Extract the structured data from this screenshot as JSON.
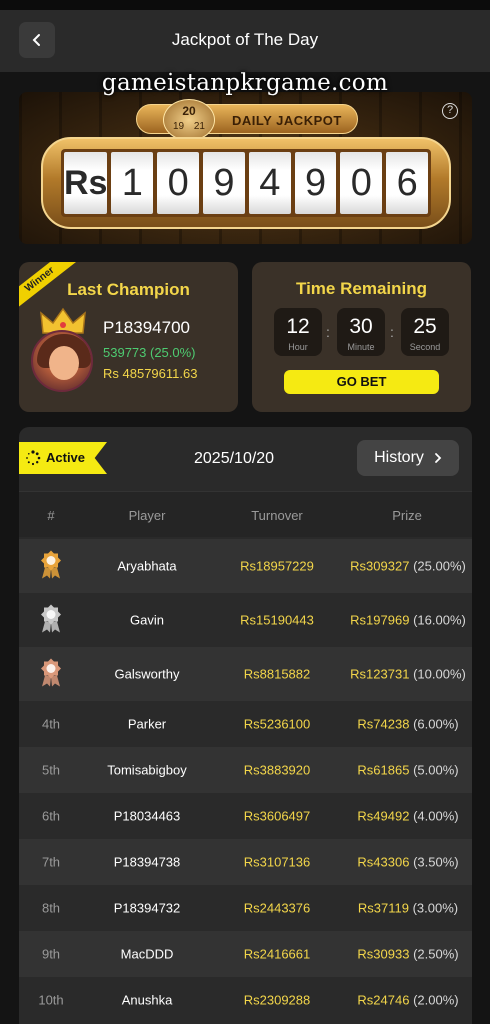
{
  "header": {
    "title": "Jackpot of The Day"
  },
  "watermark": "gameistanpkrgame.com",
  "banner": {
    "label": "DAILY JACKPOT",
    "clock": {
      "day": "20",
      "left": "19",
      "right": "21"
    },
    "currency": "Rs",
    "digits": [
      "1",
      "0",
      "9",
      "4",
      "9",
      "0",
      "6"
    ]
  },
  "champion": {
    "tag": "Winner",
    "title": "Last Champion",
    "name": "P18394700",
    "turnover_rate": "539773 (25.0%)",
    "amount": "Rs 48579611.63"
  },
  "timer": {
    "title": "Time Remaining",
    "hour": "12",
    "hour_label": "Hour",
    "minute": "30",
    "minute_label": "Minute",
    "second": "25",
    "second_label": "Second",
    "button": "GO BET"
  },
  "board": {
    "status": "Active",
    "date": "2025/10/20",
    "history": "History",
    "columns": {
      "rank": "#",
      "player": "Player",
      "turnover": "Turnover",
      "prize": "Prize"
    },
    "rows": [
      {
        "rank": "",
        "medal": "gold",
        "player": "Aryabhata",
        "turnover": "Rs18957229",
        "prize": "Rs309327",
        "pct": "(25.00%)"
      },
      {
        "rank": "",
        "medal": "silver",
        "player": "Gavin",
        "turnover": "Rs15190443",
        "prize": "Rs197969",
        "pct": "(16.00%)"
      },
      {
        "rank": "",
        "medal": "bronze",
        "player": "Galsworthy",
        "turnover": "Rs8815882",
        "prize": "Rs123731",
        "pct": "(10.00%)"
      },
      {
        "rank": "4th",
        "player": "Parker",
        "turnover": "Rs5236100",
        "prize": "Rs74238",
        "pct": "(6.00%)"
      },
      {
        "rank": "5th",
        "player": "Tomisabigboy",
        "turnover": "Rs3883920",
        "prize": "Rs61865",
        "pct": "(5.00%)"
      },
      {
        "rank": "6th",
        "player": "P18034463",
        "turnover": "Rs3606497",
        "prize": "Rs49492",
        "pct": "(4.00%)"
      },
      {
        "rank": "7th",
        "player": "P18394738",
        "turnover": "Rs3107136",
        "prize": "Rs43306",
        "pct": "(3.50%)"
      },
      {
        "rank": "8th",
        "player": "P18394732",
        "turnover": "Rs2443376",
        "prize": "Rs37119",
        "pct": "(3.00%)"
      },
      {
        "rank": "9th",
        "player": "MacDDD",
        "turnover": "Rs2416661",
        "prize": "Rs30933",
        "pct": "(2.50%)"
      },
      {
        "rank": "10th",
        "player": "Anushka",
        "turnover": "Rs2309288",
        "prize": "Rs24746",
        "pct": "(2.00%)"
      }
    ]
  },
  "colors": {
    "accent_yellow": "#f5ea12",
    "gold_text": "#f3d64a",
    "green": "#4ecb71",
    "gold": "#e8a33a",
    "silver": "#c8c8c8",
    "bronze": "#d9987a"
  },
  "icons": {
    "back": "chevron-left-icon",
    "help": "question-icon",
    "history": "chevron-right-icon",
    "active": "spinner-icon",
    "crown": "crown-icon"
  }
}
